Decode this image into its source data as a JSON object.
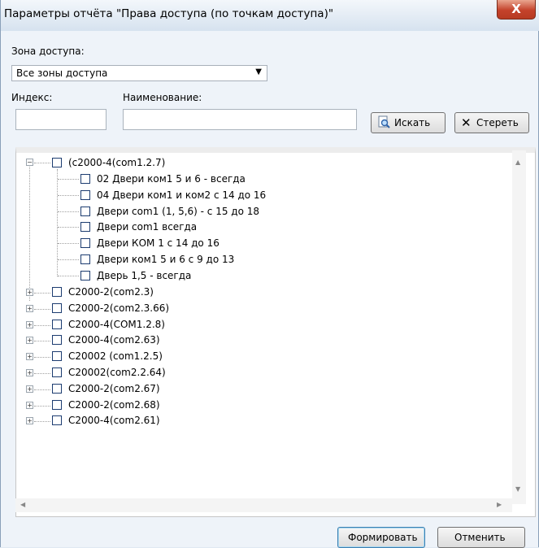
{
  "window": {
    "title": "Параметры отчёта \"Права доступа (по точкам доступа)\"",
    "close": "X"
  },
  "zone": {
    "label": "Зона доступа:",
    "selected": "Все зоны доступа"
  },
  "filters": {
    "index_label": "Индекс:",
    "index_value": "",
    "name_label": "Наименование:",
    "name_value": "",
    "search_label": "Искать",
    "clear_label": "Стереть"
  },
  "tree": {
    "expanded_root": {
      "label": "(c2000-4(com1.2.7)",
      "children": [
        "02 Двери ком1 5 и 6 - всегда",
        "04 Двери ком1 и ком2 с 14 до 16",
        "Двери com1 (1, 5,6) - с 15 до 18",
        "Двери com1 всегда",
        "Двери КОМ 1 с 14 до 16",
        "Двери ком1 5 и 6 с 9 до 13",
        "Дверь 1,5 - всегда"
      ]
    },
    "collapsed_roots": [
      "C2000-2(com2.3)",
      "C2000-2(com2.3.66)",
      "C2000-4(COM1.2.8)",
      "C2000-4(com2.63)",
      "C20002 (com1.2.5)",
      "C20002(com2.2.64)",
      "C2000-2(com2.67)",
      "C2000-2(com2.68)",
      "C2000-4(com2.61)"
    ]
  },
  "footer": {
    "build_label": "Формировать",
    "cancel_label": "Отменить"
  },
  "colors": {
    "accent": "#c4422b",
    "title_bar": "#dce6f2"
  }
}
